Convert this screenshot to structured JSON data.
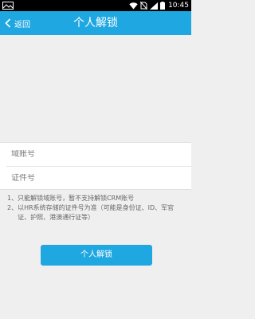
{
  "status_bar": {
    "time": "10:45",
    "icons": [
      "image-icon",
      "wifi-icon",
      "no-sim-icon",
      "signal-icon",
      "battery-icon"
    ]
  },
  "header": {
    "back_label": "返回",
    "title": "个人解锁",
    "background_color": "#1fa7e1"
  },
  "form": {
    "domain_account_placeholder": "域账号",
    "id_number_placeholder": "证件号"
  },
  "notes": [
    {
      "num": "1、",
      "text": "只能解锁域账号，暂不支持解锁CRM账号"
    },
    {
      "num": "2、",
      "text": "以HR系统存储的证件号为准（可能是身份证、ID、军官证、护照、港澳通行证等）"
    }
  ],
  "unlock_button": {
    "label": "个人解锁",
    "color": "#1fa7e1"
  }
}
